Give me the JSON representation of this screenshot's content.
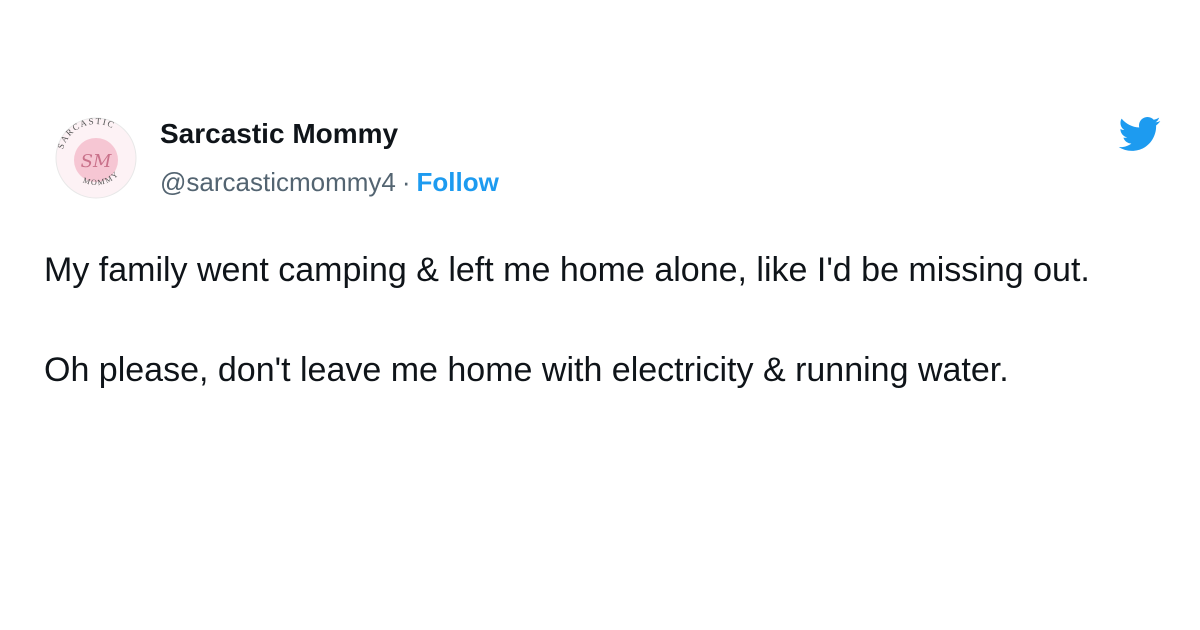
{
  "tweet": {
    "author": {
      "display_name": "Sarcastic Mommy",
      "handle": "@sarcasticmommy4",
      "separator": "·",
      "follow_label": "Follow",
      "avatar": {
        "icon": "avatar-logo",
        "ring_text_top": "SARCASTIC",
        "ring_text_bottom": "MOMMY",
        "monogram": "SM"
      }
    },
    "platform_icon": "twitter-bird-icon",
    "paragraphs": [
      "My family went camping & left me home alone, like I'd be missing out.",
      "Oh please, don't leave me home with electricity & running water."
    ]
  },
  "colors": {
    "text": "#0f1419",
    "secondary_text": "#536471",
    "accent": "#1d9bf0",
    "avatar_pink": "#f6c6d3"
  }
}
